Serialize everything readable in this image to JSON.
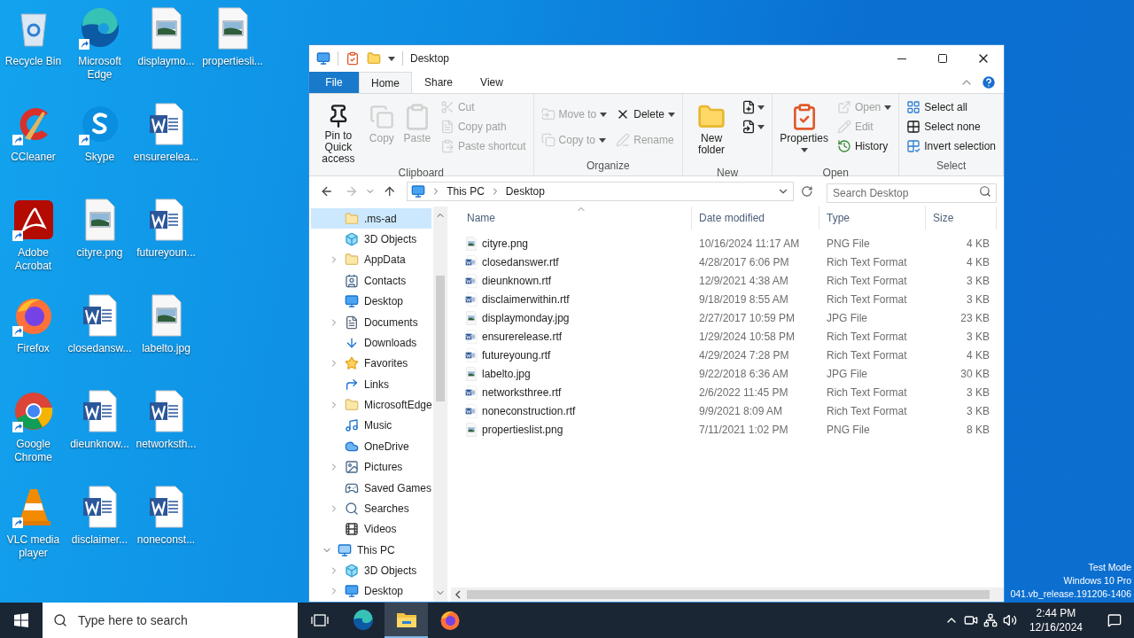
{
  "desktop": {
    "columns": [
      [
        {
          "label": "Recycle Bin",
          "kind": "app",
          "shortcut": false
        },
        {
          "label": "CCleaner",
          "kind": "app",
          "shortcut": true
        },
        {
          "label": "Adobe Acrobat",
          "kind": "app",
          "shortcut": true
        },
        {
          "label": "Firefox",
          "kind": "app",
          "shortcut": true
        },
        {
          "label": "Google Chrome",
          "kind": "app",
          "shortcut": true
        },
        {
          "label": "VLC media player",
          "kind": "app",
          "shortcut": true
        }
      ],
      [
        {
          "label": "Microsoft Edge",
          "kind": "app",
          "shortcut": true
        },
        {
          "label": "Skype",
          "kind": "app",
          "shortcut": true
        },
        {
          "label": "cityre.png",
          "kind": "image",
          "shortcut": false
        },
        {
          "label": "closedansw...",
          "kind": "document",
          "shortcut": false
        },
        {
          "label": "dieunknow...",
          "kind": "document",
          "shortcut": false
        },
        {
          "label": "disclaimer...",
          "kind": "document",
          "shortcut": false
        }
      ],
      [
        {
          "label": "displaymo...",
          "kind": "image",
          "shortcut": false
        },
        {
          "label": "ensurerelea...",
          "kind": "document",
          "shortcut": false
        },
        {
          "label": "futureyoun...",
          "kind": "document",
          "shortcut": false
        },
        {
          "label": "labelto.jpg",
          "kind": "image",
          "shortcut": false
        },
        {
          "label": "networksth...",
          "kind": "document",
          "shortcut": false
        },
        {
          "label": "noneconst...",
          "kind": "document",
          "shortcut": false
        }
      ],
      [
        {
          "label": "propertiesli...",
          "kind": "image",
          "shortcut": false
        }
      ]
    ],
    "watermark": [
      "Test Mode",
      "Windows 10 Pro",
      "041.vb_release.191206-1406"
    ]
  },
  "window": {
    "title": "Desktop",
    "tabs": [
      {
        "label": "File",
        "kind": "file",
        "selected": false
      },
      {
        "label": "Home",
        "kind": "tab",
        "selected": true
      },
      {
        "label": "Share",
        "kind": "tab",
        "selected": false
      },
      {
        "label": "View",
        "kind": "tab",
        "selected": false
      }
    ],
    "ribbon": [
      {
        "label": "Clipboard",
        "columns": [
          [
            {
              "label": "Pin to Quick access",
              "kind": "large",
              "disabled": false,
              "dropdown": false
            }
          ],
          [
            {
              "label": "Copy",
              "kind": "large",
              "disabled": true,
              "dropdown": false
            }
          ],
          [
            {
              "label": "Paste",
              "kind": "large",
              "disabled": true,
              "dropdown": false
            }
          ],
          [
            {
              "label": "Cut",
              "kind": "small",
              "disabled": true,
              "dropdown": false
            },
            {
              "label": "Copy path",
              "kind": "small",
              "disabled": true,
              "dropdown": false
            },
            {
              "label": "Paste shortcut",
              "kind": "small",
              "disabled": true,
              "dropdown": false
            }
          ]
        ]
      },
      {
        "label": "Organize",
        "columns": [
          [
            {
              "label": "Move to",
              "kind": "small",
              "disabled": true,
              "dropdown": true
            },
            {
              "label": "Copy to",
              "kind": "small",
              "disabled": true,
              "dropdown": true
            }
          ],
          [
            {
              "label": "Delete",
              "kind": "small",
              "disabled": false,
              "dropdown": true
            },
            {
              "label": "Rename",
              "kind": "small",
              "disabled": true,
              "dropdown": false
            }
          ]
        ]
      },
      {
        "label": "New",
        "columns": [
          [
            {
              "label": "New folder",
              "kind": "large",
              "disabled": false,
              "dropdown": false
            }
          ],
          [
            {
              "kind": "icon",
              "disabled": false,
              "dropdown": true
            },
            {
              "kind": "icon",
              "disabled": false,
              "dropdown": true
            }
          ]
        ]
      },
      {
        "label": "Open",
        "columns": [
          [
            {
              "label": "Properties",
              "kind": "large",
              "disabled": false,
              "dropdown": true
            }
          ],
          [
            {
              "label": "Open",
              "kind": "small",
              "disabled": true,
              "dropdown": true
            },
            {
              "label": "Edit",
              "kind": "small",
              "disabled": true,
              "dropdown": false
            },
            {
              "label": "History",
              "kind": "small",
              "disabled": false,
              "dropdown": false
            }
          ]
        ]
      },
      {
        "label": "Select",
        "columns": [
          [
            {
              "label": "Select all",
              "kind": "small",
              "disabled": false,
              "dropdown": false
            },
            {
              "label": "Select none",
              "kind": "small",
              "disabled": false,
              "dropdown": false
            },
            {
              "label": "Invert selection",
              "kind": "small",
              "disabled": false,
              "dropdown": false
            }
          ]
        ]
      }
    ],
    "address": {
      "crumbs": [
        "This PC",
        "Desktop"
      ],
      "search_placeholder": "Search Desktop"
    },
    "nav_pane": {
      "scrolled_items": [
        {
          "label": ".ms-ad",
          "expandable": false,
          "selected": true
        },
        {
          "label": "3D Objects",
          "expandable": false,
          "selected": false
        },
        {
          "label": "AppData",
          "expandable": true,
          "selected": false
        },
        {
          "label": "Contacts",
          "expandable": false,
          "selected": false
        },
        {
          "label": "Desktop",
          "expandable": false,
          "selected": false
        },
        {
          "label": "Documents",
          "expandable": true,
          "selected": false
        },
        {
          "label": "Downloads",
          "expandable": false,
          "selected": false
        },
        {
          "label": "Favorites",
          "expandable": true,
          "selected": false
        },
        {
          "label": "Links",
          "expandable": false,
          "selected": false
        },
        {
          "label": "MicrosoftEdge",
          "expandable": true,
          "selected": false
        },
        {
          "label": "Music",
          "expandable": false,
          "selected": false
        },
        {
          "label": "OneDrive",
          "expandable": false,
          "selected": false
        },
        {
          "label": "Pictures",
          "expandable": true,
          "selected": false
        },
        {
          "label": "Saved Games",
          "expandable": false,
          "selected": false
        },
        {
          "label": "Searches",
          "expandable": true,
          "selected": false
        },
        {
          "label": "Videos",
          "expandable": false,
          "selected": false
        }
      ],
      "tree": [
        {
          "label": "This PC",
          "expandable": true,
          "expanded": true,
          "selected": false,
          "children": [
            {
              "label": "3D Objects",
              "expandable": true,
              "expanded": false,
              "selected": false
            },
            {
              "label": "Desktop",
              "expandable": true,
              "expanded": false,
              "selected": false
            }
          ]
        }
      ]
    },
    "files": {
      "columns": [
        {
          "label": "Name",
          "sorted": true
        },
        {
          "label": "Date modified",
          "sorted": false
        },
        {
          "label": "Type",
          "sorted": false
        },
        {
          "label": "Size",
          "sorted": false
        }
      ],
      "rows": [
        {
          "name": "cityre.png",
          "date": "10/16/2024 11:17 AM",
          "type": "PNG File",
          "size": "4 KB",
          "kind": "image"
        },
        {
          "name": "closedanswer.rtf",
          "date": "4/28/2017 6:06 PM",
          "type": "Rich Text Format",
          "size": "4 KB",
          "kind": "document"
        },
        {
          "name": "dieunknown.rtf",
          "date": "12/9/2021 4:38 AM",
          "type": "Rich Text Format",
          "size": "3 KB",
          "kind": "document"
        },
        {
          "name": "disclaimerwithin.rtf",
          "date": "9/18/2019 8:55 AM",
          "type": "Rich Text Format",
          "size": "3 KB",
          "kind": "document"
        },
        {
          "name": "displaymonday.jpg",
          "date": "2/27/2017 10:59 PM",
          "type": "JPG File",
          "size": "23 KB",
          "kind": "image"
        },
        {
          "name": "ensurerelease.rtf",
          "date": "1/29/2024 10:58 PM",
          "type": "Rich Text Format",
          "size": "3 KB",
          "kind": "document"
        },
        {
          "name": "futureyoung.rtf",
          "date": "4/29/2024 7:28 PM",
          "type": "Rich Text Format",
          "size": "4 KB",
          "kind": "document"
        },
        {
          "name": "labelto.jpg",
          "date": "9/22/2018 6:36 AM",
          "type": "JPG File",
          "size": "30 KB",
          "kind": "image"
        },
        {
          "name": "networksthree.rtf",
          "date": "2/6/2022 11:45 PM",
          "type": "Rich Text Format",
          "size": "3 KB",
          "kind": "document"
        },
        {
          "name": "noneconstruction.rtf",
          "date": "9/9/2021 8:09 AM",
          "type": "Rich Text Format",
          "size": "3 KB",
          "kind": "document"
        },
        {
          "name": "propertieslist.png",
          "date": "7/11/2021 1:02 PM",
          "type": "PNG File",
          "size": "8 KB",
          "kind": "image"
        }
      ]
    }
  },
  "taskbar": {
    "search_placeholder": "Type here to search",
    "buttons": [
      {
        "selected": false
      },
      {
        "selected": false
      },
      {
        "selected": true
      },
      {
        "selected": false
      }
    ],
    "time": "2:44 PM",
    "date": "12/16/2024"
  }
}
